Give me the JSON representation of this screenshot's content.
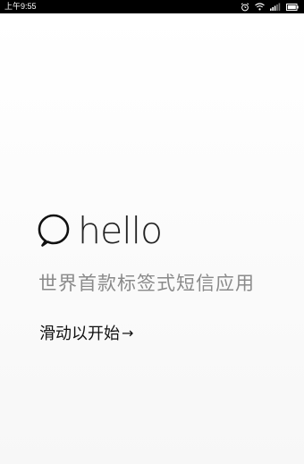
{
  "status_bar": {
    "time": "上午9:55",
    "icons": [
      "alarm-icon",
      "wifi-icon",
      "signal-icon",
      "battery-icon"
    ]
  },
  "intro": {
    "logo_word": "hello",
    "tagline": "世界首款标签式短信应用",
    "start_label": "滑动以开始",
    "start_arrow": "→"
  },
  "colors": {
    "status_bar_bg": "#000000",
    "background": "#fbfbfb",
    "tagline": "#8a8a8a",
    "text": "#111111"
  }
}
